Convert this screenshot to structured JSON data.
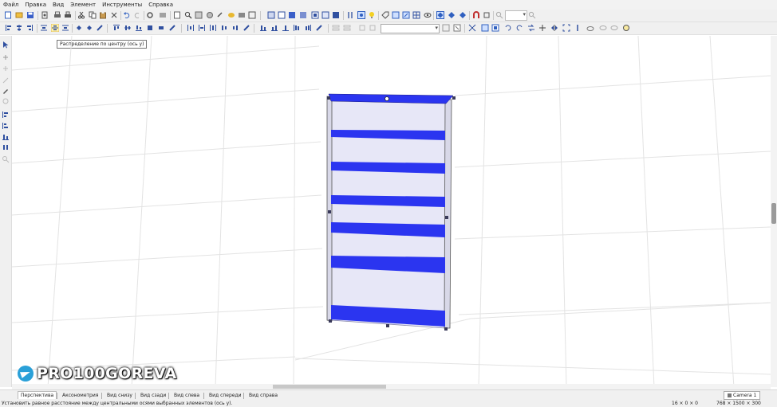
{
  "menu": {
    "items": [
      "Файл",
      "Правка",
      "Вид",
      "Элемент",
      "Инструменты",
      "Справка"
    ]
  },
  "tooltip": {
    "text": "Распределение по центру (ось у)"
  },
  "view_tabs": {
    "items": [
      "Перспектива",
      "Аксонометрия",
      "Вид снизу",
      "Вид сзади",
      "Вид слева",
      "Вид спереди",
      "Вид справа"
    ],
    "active": "Перспектива"
  },
  "camera": {
    "label": "Camera 1"
  },
  "status": {
    "message": "Установить равное расстояние между центральными осями выбранных элементов (ось у).",
    "coords": "16 × 0 × 0",
    "dims": "768 × 1500 × 300"
  },
  "watermark": {
    "text": "PRO100GOREVA"
  },
  "colors": {
    "accent": "#2b35f0",
    "toolbar_bg": "#f0f0f0",
    "telegram": "#2aa0d8"
  },
  "icons": [
    "pointer-icon",
    "new-file-icon",
    "open-folder-icon",
    "save-icon",
    "print-icon",
    "cut-icon",
    "copy-icon",
    "paste-icon",
    "delete-icon",
    "undo-icon",
    "redo-icon",
    "zoom-icon",
    "light-bulb-icon",
    "magnet-icon",
    "align-icon",
    "distribute-icon",
    "telegram-icon",
    "camera-icon"
  ]
}
